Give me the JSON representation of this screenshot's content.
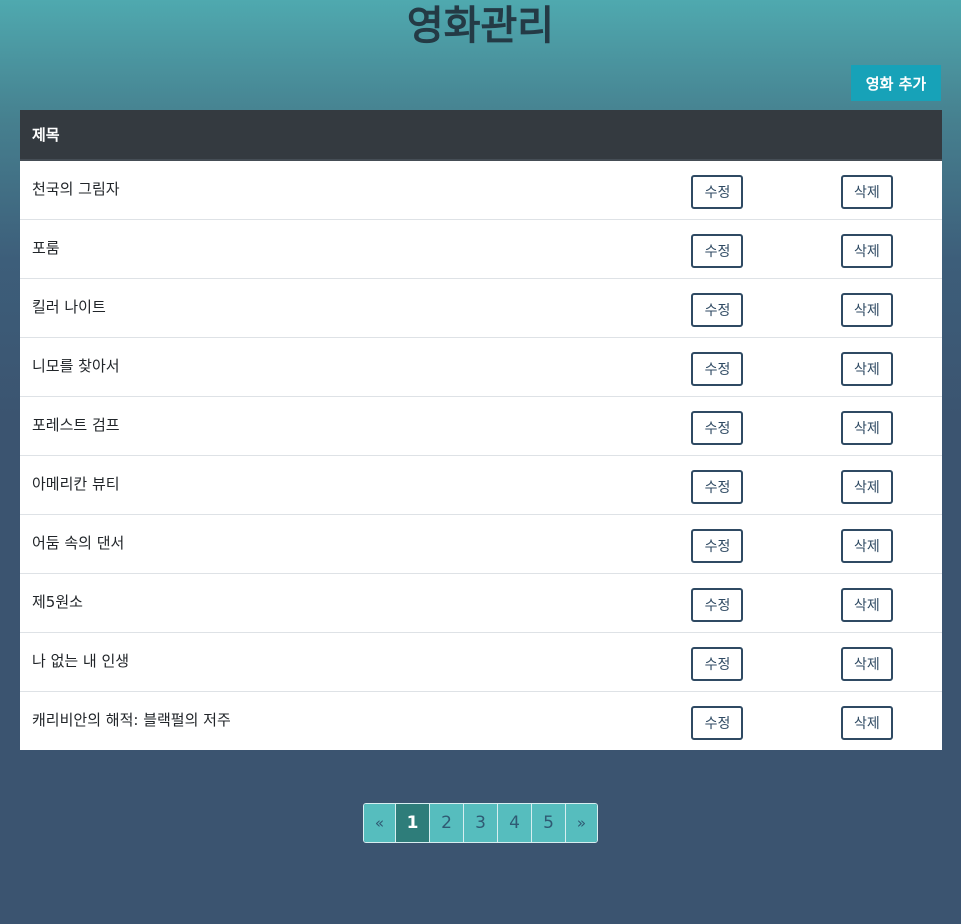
{
  "header": {
    "title": "영화관리"
  },
  "toolbar": {
    "add_label": "영화 추가"
  },
  "table": {
    "columns": [
      "제목",
      "",
      ""
    ],
    "edit_label": "수정",
    "delete_label": "삭제",
    "rows": [
      {
        "title": "천국의 그림자"
      },
      {
        "title": "포룸"
      },
      {
        "title": "킬러 나이트"
      },
      {
        "title": "니모를 찾아서"
      },
      {
        "title": "포레스트 검프"
      },
      {
        "title": "아메리칸 뷰티"
      },
      {
        "title": "어둠 속의 댄서"
      },
      {
        "title": "제5원소"
      },
      {
        "title": "나 없는 내 인생"
      },
      {
        "title": "캐리비안의 해적: 블랙펄의 저주"
      }
    ]
  },
  "pagination": {
    "prev": "«",
    "next": "»",
    "pages": [
      "1",
      "2",
      "3",
      "4",
      "5"
    ],
    "current": "1"
  },
  "colors": {
    "primary_button": "#17a2b8",
    "table_header": "#343a40",
    "outline": "#2f4a63",
    "page_link": "#56bdbe",
    "page_active": "#2e7d7a"
  }
}
